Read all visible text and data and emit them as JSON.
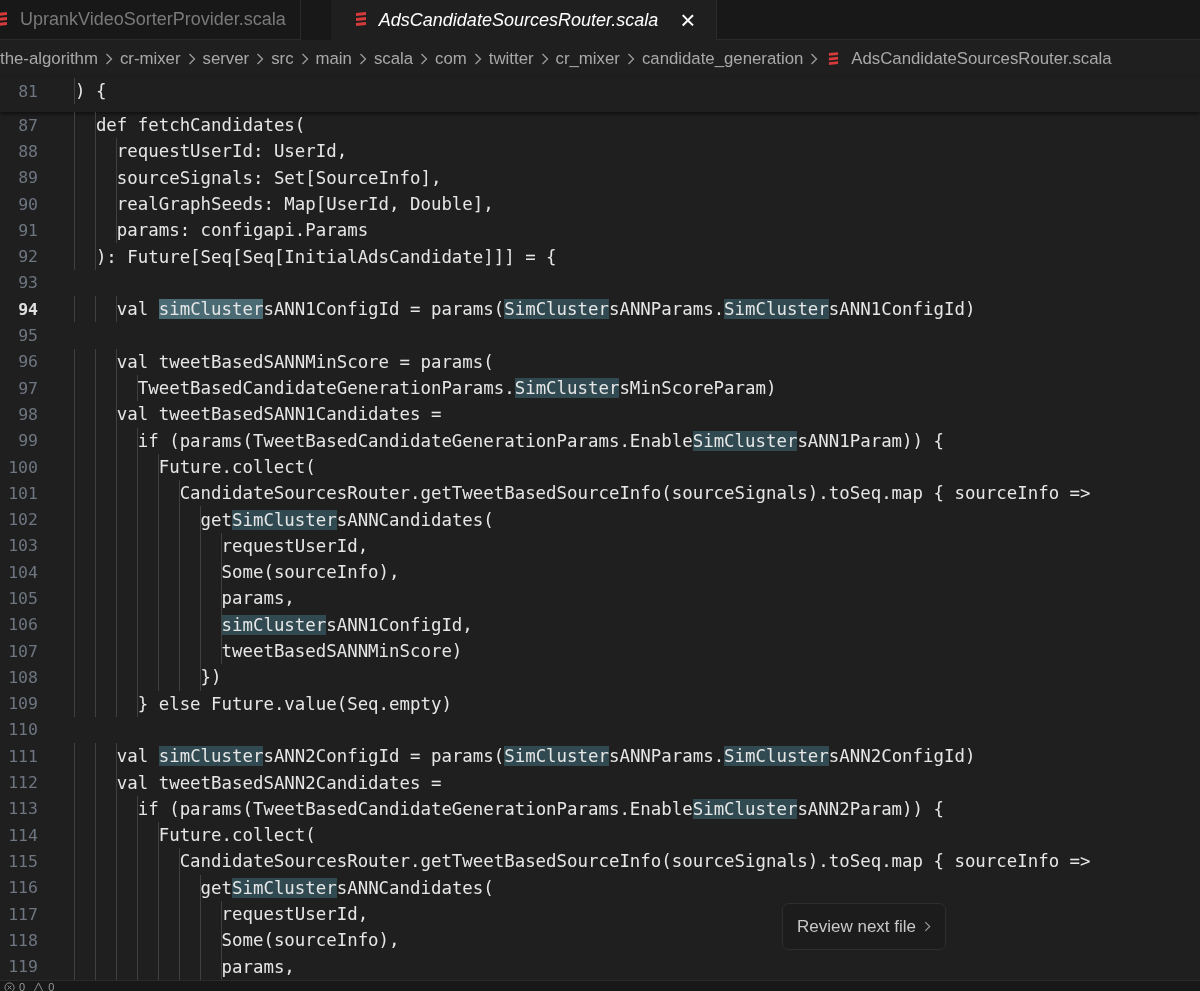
{
  "tabs": [
    {
      "label": "UprankVideoSorterProvider.scala",
      "selected": false
    },
    {
      "label": "AdsCandidateSourcesRouter.scala",
      "selected": true,
      "close": "×"
    }
  ],
  "breadcrumb": [
    {
      "label": "the-algorithm",
      "file": false
    },
    {
      "label": "cr-mixer",
      "file": false
    },
    {
      "label": "server",
      "file": false
    },
    {
      "label": "src",
      "file": false
    },
    {
      "label": "main",
      "file": false
    },
    {
      "label": "scala",
      "file": false
    },
    {
      "label": "com",
      "file": false
    },
    {
      "label": "twitter",
      "file": false
    },
    {
      "label": "cr_mixer",
      "file": false
    },
    {
      "label": "candidate_generation",
      "file": false
    },
    {
      "label": "AdsCandidateSourcesRouter.scala",
      "file": true
    }
  ],
  "sticky_lines": [
    {
      "number": "81",
      "current": false,
      "segments": [
        {
          "text": "  ) {",
          "highlighted": false,
          "strong": false
        }
      ]
    }
  ],
  "lines": [
    {
      "number": "87",
      "current": false,
      "segments": [
        {
          "text": "    def fetchCandidates(",
          "highlighted": false,
          "strong": false
        }
      ]
    },
    {
      "number": "88",
      "current": false,
      "segments": [
        {
          "text": "      requestUserId: UserId,",
          "highlighted": false,
          "strong": false
        }
      ]
    },
    {
      "number": "89",
      "current": false,
      "segments": [
        {
          "text": "      sourceSignals: Set[SourceInfo],",
          "highlighted": false,
          "strong": false
        }
      ]
    },
    {
      "number": "90",
      "current": false,
      "segments": [
        {
          "text": "      realGraphSeeds: Map[UserId, Double],",
          "highlighted": false,
          "strong": false
        }
      ]
    },
    {
      "number": "91",
      "current": false,
      "segments": [
        {
          "text": "      params: configapi.Params",
          "highlighted": false,
          "strong": false
        }
      ]
    },
    {
      "number": "92",
      "current": false,
      "segments": [
        {
          "text": "    ): Future[Seq[Seq[InitialAdsCandidate]]] = {",
          "highlighted": false,
          "strong": false
        }
      ]
    },
    {
      "number": "93",
      "current": false
    },
    {
      "number": "94",
      "current": true,
      "segments": [
        {
          "text": "      val ",
          "highlighted": false,
          "strong": false
        },
        {
          "text": "simCluster",
          "highlighted": true,
          "strong": true
        },
        {
          "text": "sANN1ConfigId = params(",
          "highlighted": false,
          "strong": false
        },
        {
          "text": "SimCluster",
          "highlighted": true,
          "strong": false
        },
        {
          "text": "sANNParams.",
          "highlighted": false,
          "strong": false
        },
        {
          "text": "SimCluster",
          "highlighted": true,
          "strong": false
        },
        {
          "text": "sANN1ConfigId)",
          "highlighted": false,
          "strong": false
        }
      ]
    },
    {
      "number": "95",
      "current": false
    },
    {
      "number": "96",
      "current": false,
      "segments": [
        {
          "text": "      val tweetBasedSANNMinScore = params(",
          "highlighted": false,
          "strong": false
        }
      ]
    },
    {
      "number": "97",
      "current": false,
      "segments": [
        {
          "text": "        TweetBasedCandidateGenerationParams.",
          "highlighted": false,
          "strong": false
        },
        {
          "text": "SimCluster",
          "highlighted": true,
          "strong": false
        },
        {
          "text": "sMinScoreParam)",
          "highlighted": false,
          "strong": false
        }
      ]
    },
    {
      "number": "98",
      "current": false,
      "segments": [
        {
          "text": "      val tweetBasedSANN1Candidates =",
          "highlighted": false,
          "strong": false
        }
      ]
    },
    {
      "number": "99",
      "current": false,
      "segments": [
        {
          "text": "        if (params(TweetBasedCandidateGenerationParams.Enable",
          "highlighted": false,
          "strong": false
        },
        {
          "text": "SimCluster",
          "highlighted": true,
          "strong": false
        },
        {
          "text": "sANN1Param)) {",
          "highlighted": false,
          "strong": false
        }
      ]
    },
    {
      "number": "100",
      "current": false,
      "segments": [
        {
          "text": "          Future.collect(",
          "highlighted": false,
          "strong": false
        }
      ]
    },
    {
      "number": "101",
      "current": false,
      "segments": [
        {
          "text": "            CandidateSourcesRouter.getTweetBasedSourceInfo(sourceSignals).toSeq.map { sourceInfo =>",
          "highlighted": false,
          "strong": false
        }
      ]
    },
    {
      "number": "102",
      "current": false,
      "segments": [
        {
          "text": "              get",
          "highlighted": false,
          "strong": false
        },
        {
          "text": "SimCluster",
          "highlighted": true,
          "strong": false
        },
        {
          "text": "sANNCandidates(",
          "highlighted": false,
          "strong": false
        }
      ]
    },
    {
      "number": "103",
      "current": false,
      "segments": [
        {
          "text": "                requestUserId,",
          "highlighted": false,
          "strong": false
        }
      ]
    },
    {
      "number": "104",
      "current": false,
      "segments": [
        {
          "text": "                Some(sourceInfo),",
          "highlighted": false,
          "strong": false
        }
      ]
    },
    {
      "number": "105",
      "current": false,
      "segments": [
        {
          "text": "                params,",
          "highlighted": false,
          "strong": false
        }
      ]
    },
    {
      "number": "106",
      "current": false,
      "segments": [
        {
          "text": "                simCluster",
          "highlighted": true,
          "strong": false
        },
        {
          "text": "sANN1ConfigId,",
          "highlighted": false,
          "strong": false
        }
      ]
    },
    {
      "number": "107",
      "current": false,
      "segments": [
        {
          "text": "                tweetBasedSANNMinScore)",
          "highlighted": false,
          "strong": false
        }
      ]
    },
    {
      "number": "108",
      "current": false,
      "segments": [
        {
          "text": "              })",
          "highlighted": false,
          "strong": false
        }
      ]
    },
    {
      "number": "109",
      "current": false,
      "segments": [
        {
          "text": "        } else Future.value(Seq.empty)",
          "highlighted": false,
          "strong": false
        }
      ]
    },
    {
      "number": "110",
      "current": false
    },
    {
      "number": "111",
      "current": false,
      "segments": [
        {
          "text": "      val ",
          "highlighted": false,
          "strong": false
        },
        {
          "text": "simCluster",
          "highlighted": true,
          "strong": false
        },
        {
          "text": "sANN2ConfigId = params(",
          "highlighted": false,
          "strong": false
        },
        {
          "text": "SimCluster",
          "highlighted": true,
          "strong": false
        },
        {
          "text": "sANNParams.",
          "highlighted": false,
          "strong": false
        },
        {
          "text": "SimCluster",
          "highlighted": true,
          "strong": false
        },
        {
          "text": "sANN2ConfigId)",
          "highlighted": false,
          "strong": false
        }
      ]
    },
    {
      "number": "112",
      "current": false,
      "segments": [
        {
          "text": "      val tweetBasedSANN2Candidates =",
          "highlighted": false,
          "strong": false
        }
      ]
    },
    {
      "number": "113",
      "current": false,
      "segments": [
        {
          "text": "        if (params(TweetBasedCandidateGenerationParams.Enable",
          "highlighted": false,
          "strong": false
        },
        {
          "text": "SimCluster",
          "highlighted": true,
          "strong": false
        },
        {
          "text": "sANN2Param)) {",
          "highlighted": false,
          "strong": false
        }
      ]
    },
    {
      "number": "114",
      "current": false,
      "segments": [
        {
          "text": "          Future.collect(",
          "highlighted": false,
          "strong": false
        }
      ]
    },
    {
      "number": "115",
      "current": false,
      "segments": [
        {
          "text": "            CandidateSourcesRouter.getTweetBasedSourceInfo(sourceSignals).toSeq.map { sourceInfo =>",
          "highlighted": false,
          "strong": false
        }
      ]
    },
    {
      "number": "116",
      "current": false,
      "segments": [
        {
          "text": "              get",
          "highlighted": false,
          "strong": false
        },
        {
          "text": "SimCluster",
          "highlighted": true,
          "strong": false
        },
        {
          "text": "sANNCandidates(",
          "highlighted": false,
          "strong": false
        }
      ]
    },
    {
      "number": "117",
      "current": false,
      "segments": [
        {
          "text": "                requestUserId,",
          "highlighted": false,
          "strong": false
        }
      ]
    },
    {
      "number": "118",
      "current": false,
      "segments": [
        {
          "text": "                Some(sourceInfo),",
          "highlighted": false,
          "strong": false
        }
      ]
    },
    {
      "number": "119",
      "current": false,
      "segments": [
        {
          "text": "                params,",
          "highlighted": false,
          "strong": false
        }
      ]
    }
  ],
  "review_button": {
    "label": "Review next file"
  },
  "status_bar": {
    "errors": "0",
    "warnings": "0"
  }
}
